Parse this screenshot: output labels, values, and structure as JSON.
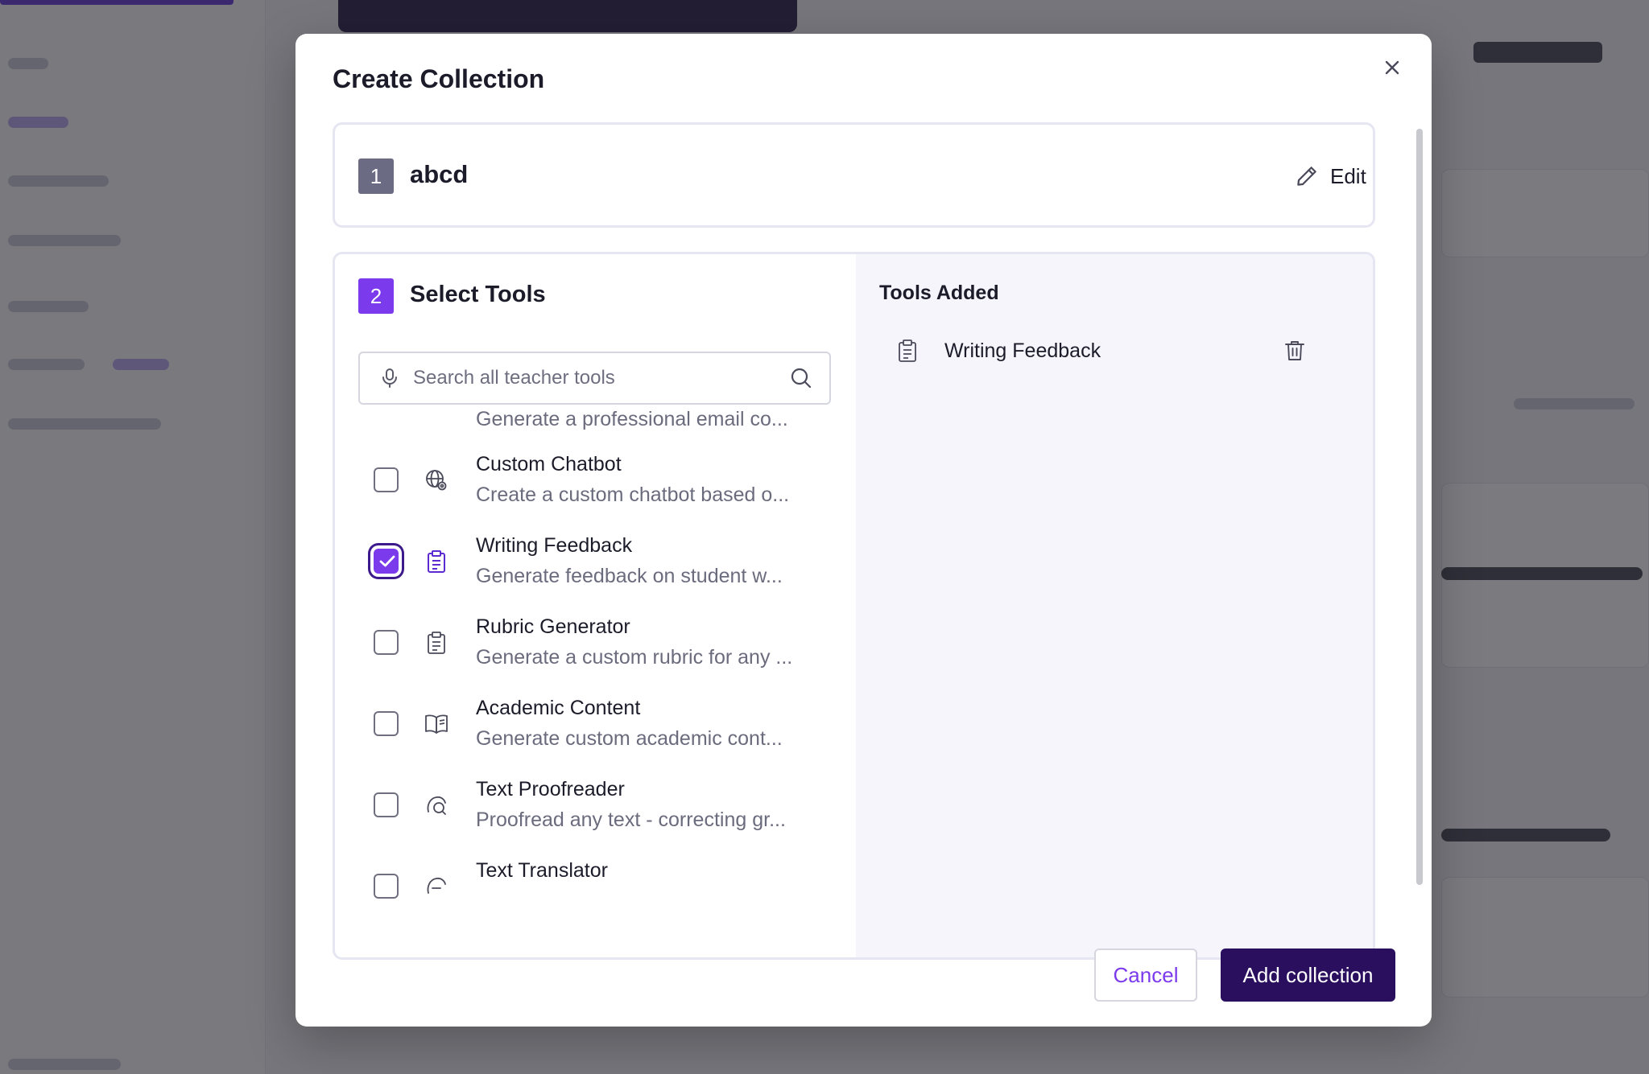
{
  "modal": {
    "title": "Create Collection",
    "close_icon": "close-icon"
  },
  "step1": {
    "number": "1",
    "name": "abcd",
    "edit_label": "Edit",
    "edit_icon": "pencil-icon"
  },
  "step2": {
    "number": "2",
    "title": "Select Tools",
    "search": {
      "placeholder": "Search all teacher tools",
      "value": ""
    },
    "partial_top_desc": "Generate a professional email co...",
    "tools": [
      {
        "name": "Custom Chatbot",
        "desc": "Create a custom chatbot based o...",
        "checked": false,
        "icon": "globe-icon"
      },
      {
        "name": "Writing Feedback",
        "desc": "Generate feedback on student w...",
        "checked": true,
        "icon": "clipboard-icon"
      },
      {
        "name": "Rubric Generator",
        "desc": "Generate a custom rubric for any ...",
        "checked": false,
        "icon": "clipboard-icon"
      },
      {
        "name": "Academic Content",
        "desc": "Generate custom academic cont...",
        "checked": false,
        "icon": "book-icon"
      },
      {
        "name": "Text Proofreader",
        "desc": "Proofread any text - correcting gr...",
        "checked": false,
        "icon": "proofread-icon"
      },
      {
        "name": "Text Translator",
        "desc": "",
        "checked": false,
        "icon": "translate-icon"
      }
    ]
  },
  "tools_added": {
    "title": "Tools Added",
    "items": [
      {
        "name": "Writing Feedback",
        "icon": "clipboard-icon",
        "remove_icon": "trash-icon"
      }
    ]
  },
  "footer": {
    "cancel_label": "Cancel",
    "add_label": "Add collection"
  },
  "colors": {
    "accent": "#7c3aed",
    "primary_button": "#2a0f5e",
    "overlay": "#6b6b73"
  }
}
